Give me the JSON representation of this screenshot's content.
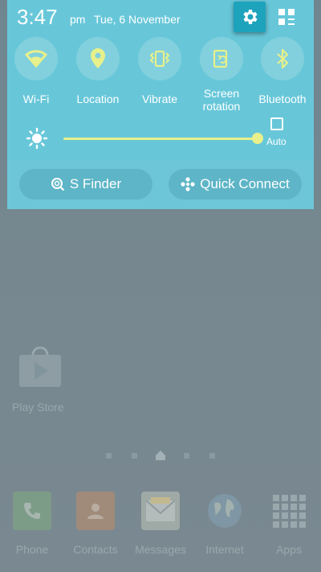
{
  "status": {
    "time": "3:47",
    "ampm": "pm",
    "date": "Tue, 6 November"
  },
  "quick_toggles": [
    {
      "label": "Wi-Fi",
      "icon": "wifi-icon"
    },
    {
      "label": "Location",
      "icon": "location-icon"
    },
    {
      "label": "Vibrate",
      "icon": "vibrate-icon"
    },
    {
      "label": "Screen rotation",
      "label_line1": "Screen",
      "label_line2": "rotation",
      "icon": "screen-rotation-icon"
    },
    {
      "label": "Bluetooth",
      "icon": "bluetooth-icon"
    }
  ],
  "brightness": {
    "auto_label": "Auto",
    "level": 1.0
  },
  "shortcuts": {
    "sfinder_label": "S Finder",
    "quick_connect_label": "Quick Connect"
  },
  "home": {
    "app_label": "Play Store",
    "dock": [
      {
        "label": "Phone",
        "icon": "phone-icon"
      },
      {
        "label": "Contacts",
        "icon": "contacts-icon"
      },
      {
        "label": "Messages",
        "icon": "messages-icon"
      },
      {
        "label": "Internet",
        "icon": "internet-icon"
      },
      {
        "label": "Apps",
        "icon": "apps-icon"
      }
    ]
  },
  "colors": {
    "panel": "#67c7d9",
    "accent_icon": "#e7f08a",
    "settings_button": "#1ea3bd",
    "dim_text": "#9aa8ad"
  }
}
